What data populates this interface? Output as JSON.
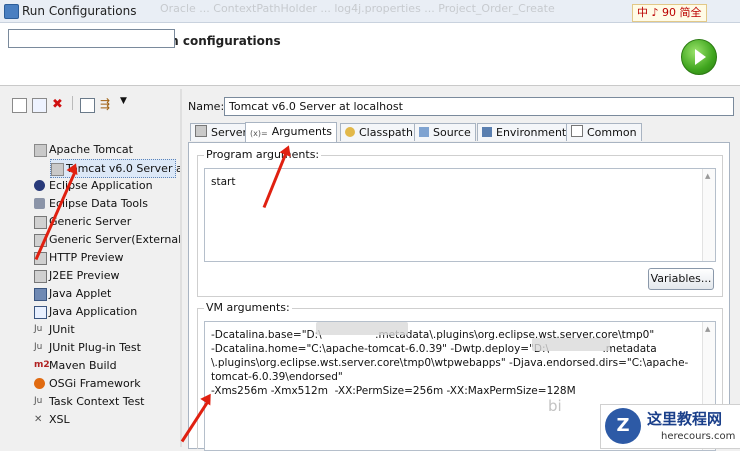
{
  "window": {
    "title": "Run Configurations",
    "bg_tabs_text": "Oracle  ...  ContextPathHolder  ...  log4j.properties  ...  Project_Order_Create"
  },
  "ime": {
    "text": "中 ♪ 90 简全"
  },
  "header": {
    "title": "Create, manage, and run configurations"
  },
  "toolbar": {
    "icons": [
      "new-config-icon",
      "duplicate-icon",
      "delete-icon",
      "collapse-all-icon",
      "filter-icon",
      "dropdown-icon"
    ]
  },
  "tree": {
    "items": [
      {
        "label": "Apache Tomcat",
        "icon": "tomcat-icon"
      },
      {
        "label": "Tomcat v6.0 Server a",
        "icon": "tomcat-icon",
        "selected": true
      },
      {
        "label": "Eclipse Application",
        "icon": "eclipse-icon"
      },
      {
        "label": "Eclipse Data Tools",
        "icon": "database-icon"
      },
      {
        "label": "Generic Server",
        "icon": "server-icon"
      },
      {
        "label": "Generic Server(External",
        "icon": "server-icon"
      },
      {
        "label": "HTTP Preview",
        "icon": "server-icon"
      },
      {
        "label": "J2EE Preview",
        "icon": "server-icon"
      },
      {
        "label": "Java Applet",
        "icon": "applet-icon"
      },
      {
        "label": "Java Application",
        "icon": "java-app-icon"
      },
      {
        "label": "JUnit",
        "icon": "junit-icon"
      },
      {
        "label": "JUnit Plug-in Test",
        "icon": "junit-plugin-icon"
      },
      {
        "label": "Maven Build",
        "icon": "maven-icon"
      },
      {
        "label": "OSGi Framework",
        "icon": "osgi-icon"
      },
      {
        "label": "Task Context Test",
        "icon": "task-icon"
      },
      {
        "label": "XSL",
        "icon": "xsl-icon"
      }
    ]
  },
  "config": {
    "name_label": "Name:",
    "name_value": "Tomcat v6.0 Server at localhost",
    "tabs": [
      {
        "label": "Server",
        "icon": "server-tab-icon"
      },
      {
        "label": "Arguments",
        "icon": "arguments-tab-icon",
        "active": true
      },
      {
        "label": "Classpath",
        "icon": "classpath-tab-icon"
      },
      {
        "label": "Source",
        "icon": "source-tab-icon"
      },
      {
        "label": "Environment",
        "icon": "environment-tab-icon"
      },
      {
        "label": "Common",
        "icon": "common-tab-icon"
      }
    ],
    "program_args_label": "Program arguments:",
    "program_args_value": "start",
    "variables_button": "Variables...",
    "vm_args_label": "VM arguments:",
    "vm_args_value": "-Dcatalina.base=\"D:\\                .metadata\\.plugins\\org.eclipse.wst.server.core\\tmp0\"\n-Dcatalina.home=\"C:\\apache-tomcat-6.0.39\" -Dwtp.deploy=\"D:\\                .metadata\n\\.plugins\\org.eclipse.wst.server.core\\tmp0\\wtpwebapps\" -Djava.endorsed.dirs=\"C:\\apache-\ntomcat-6.0.39\\endorsed\"\n-Xms256m -Xmx512m  -XX:PermSize=256m -XX:MaxPermSize=128M"
  },
  "watermark": {
    "left_text": "bi",
    "site_cn": "这里教程网",
    "site_en": "herecours.com"
  },
  "colors": {
    "annotation_arrow": "#e02010",
    "selection": "#dce8f7",
    "run_button": "#3fa51e"
  }
}
